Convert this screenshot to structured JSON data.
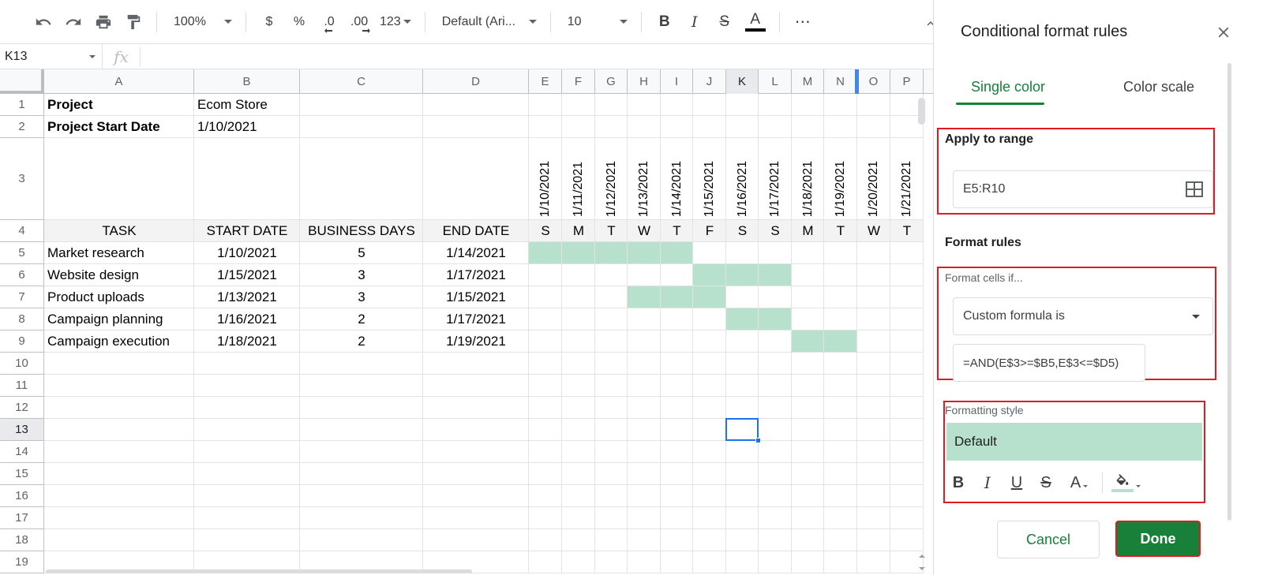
{
  "toolbar": {
    "zoom": "100%",
    "currency": "$",
    "percent": "%",
    "decrease_decimal": ".0",
    "increase_decimal": ".00",
    "more_formats": "123",
    "font_family": "Default (Ari...",
    "font_size": "10",
    "bold": "B",
    "italic": "I",
    "strikethrough": "S",
    "text_color": "A",
    "more": "⋯",
    "icons": [
      "undo-icon",
      "redo-icon",
      "print-icon",
      "paint-format-icon",
      "chevron-up-icon"
    ]
  },
  "formula_bar": {
    "name_box": "K13",
    "fx": "fx",
    "formula": ""
  },
  "columns": [
    "A",
    "B",
    "C",
    "D",
    "E",
    "F",
    "G",
    "H",
    "I",
    "J",
    "K",
    "L",
    "M",
    "N",
    "O",
    "P"
  ],
  "selected_column": "K",
  "rows": [
    "1",
    "2",
    "3",
    "4",
    "5",
    "6",
    "7",
    "8",
    "9",
    "10",
    "11",
    "12",
    "13",
    "14",
    "15",
    "16",
    "17",
    "18",
    "19"
  ],
  "selected_row": "13",
  "project": {
    "project_label": "Project",
    "project_value": "Ecom Store",
    "start_label": "Project Start Date",
    "start_value": "1/10/2021"
  },
  "dates": [
    "1/10/2021",
    "1/11/2021",
    "1/12/2021",
    "1/13/2021",
    "1/14/2021",
    "1/15/2021",
    "1/16/2021",
    "1/17/2021",
    "1/18/2021",
    "1/19/2021",
    "1/20/2021",
    "1/21/2021"
  ],
  "table_headers": [
    "TASK",
    "START DATE",
    "BUSINESS DAYS",
    "END DATE"
  ],
  "weekdays": [
    "S",
    "M",
    "T",
    "W",
    "T",
    "F",
    "S",
    "S",
    "M",
    "T",
    "W",
    "T"
  ],
  "tasks": [
    {
      "task": "Market research",
      "start": "1/10/2021",
      "days": "5",
      "end": "1/14/2021"
    },
    {
      "task": "Website design",
      "start": "1/15/2021",
      "days": "3",
      "end": "1/17/2021"
    },
    {
      "task": "Product uploads",
      "start": "1/13/2021",
      "days": "3",
      "end": "1/15/2021"
    },
    {
      "task": "Campaign planning",
      "start": "1/16/2021",
      "days": "2",
      "end": "1/17/2021"
    },
    {
      "task": "Campaign execution",
      "start": "1/18/2021",
      "days": "2",
      "end": "1/19/2021"
    }
  ],
  "gantt_highlight_color": "#b7e1cd",
  "panel": {
    "title": "Conditional format rules",
    "tabs": [
      "Single color",
      "Color scale"
    ],
    "active_tab": "Single color",
    "apply_to_range_label": "Apply to range",
    "range_value": "E5:R10",
    "format_rules_label": "Format rules",
    "format_cells_if_label": "Format cells if...",
    "condition": "Custom formula is",
    "formula": "=AND(E$3>=$B5,E$3<=$D5)",
    "formatting_style_label": "Formatting style",
    "style_preview": "Default",
    "style_buttons": {
      "bold": "B",
      "italic": "I",
      "underline": "U",
      "strikethrough": "S",
      "text_color": "A"
    },
    "cancel_label": "Cancel",
    "done_label": "Done",
    "accent_color": "#188038",
    "highlight_box_color": "#e01b24"
  }
}
